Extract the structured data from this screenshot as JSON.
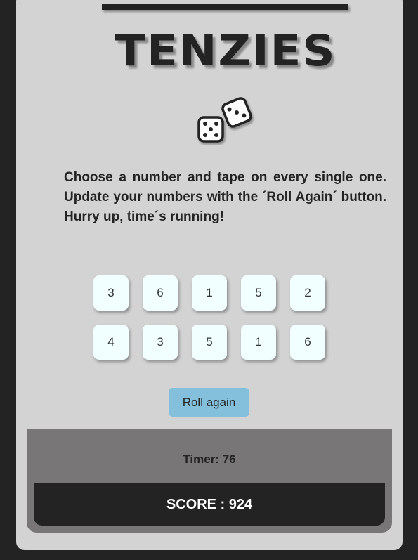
{
  "app": {
    "title": "TENZIES"
  },
  "instructions": "Choose a number and tape on every single one. Update your numbers with the ´Roll Again´ button. Hurry up, time´s running!",
  "dice": [
    "3",
    "6",
    "1",
    "5",
    "2",
    "4",
    "3",
    "5",
    "1",
    "6"
  ],
  "controls": {
    "roll_label": "Roll again"
  },
  "status": {
    "timer_text": "Timer: 76",
    "score_text": "SCORE : 924"
  },
  "colors": {
    "background": "#232323",
    "card": "#d3d3d3",
    "die_face": "#f2ffff",
    "roll_button": "#84bfdb",
    "status_panel": "#787677",
    "score_bar": "#232323"
  },
  "icons": {
    "logo": "dice-pair-icon"
  }
}
